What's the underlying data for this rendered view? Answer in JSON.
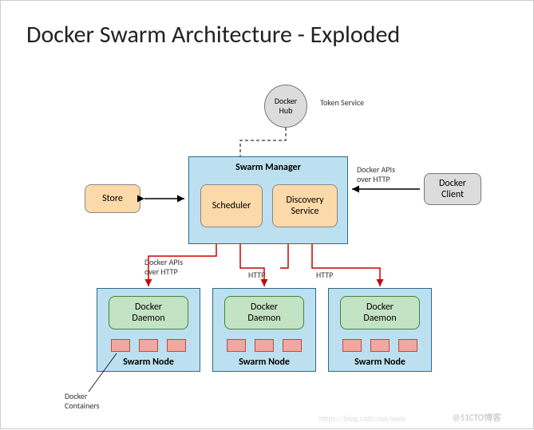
{
  "title": "Docker Swarm Architecture  - Exploded",
  "hub": "Docker\nHub",
  "tokenService": "Token Service",
  "store": "Store",
  "manager": {
    "title": "Swarm  Manager",
    "scheduler": "Scheduler",
    "discovery": "Discovery\nService"
  },
  "clientApiLabel": "Docker APIs\nover HTTP",
  "client": "Docker\nClient",
  "nodeApiLabel": "Docker APIs\nover HTTP",
  "httpLabel1": "HTTP",
  "httpLabel2": "HTTP",
  "daemon": "Docker\nDaemon",
  "nodeLabel": "Swarm  Node",
  "containersLabel": "Docker\nContainers",
  "watermark": "@51CTO博客",
  "watermark2": "https://blog.csdn.net/weix"
}
